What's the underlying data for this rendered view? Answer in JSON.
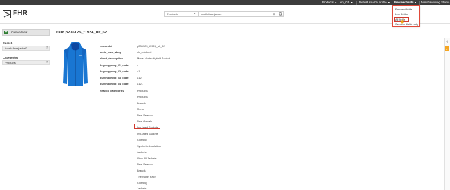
{
  "topbar": {
    "products": "Products",
    "locale": "en_GB",
    "profile": "Default search profile",
    "preview_fields": "Preview fields",
    "studio": "Merchandising Studio"
  },
  "header": {
    "logo_text": "FHR",
    "search_scope": "Products",
    "search_query": "north face jacket"
  },
  "preview_menu": {
    "items": [
      "Preview fields",
      "Live fields",
      "All fields",
      "Secured fields only"
    ],
    "selected": "All fields"
  },
  "sidebar": {
    "create_label": "Create New",
    "search_heading": "Search",
    "search_chip": "\"north face jacket\"",
    "categories_heading": "Categories",
    "categories_chip": "Products"
  },
  "item": {
    "title": "Item p236125_t1924_uk_62",
    "fields": [
      {
        "label": "secondid",
        "value": "p236125_t1924_uk_62"
      },
      {
        "label": "main_web_shop",
        "value": "uk_coldeddi"
      },
      {
        "label": "short_description",
        "value": "Mens Ventro Hybrid Jacket"
      },
      {
        "label": "buyinggroup_l1_code",
        "value": "4"
      },
      {
        "label": "buyinggroup_l2_code",
        "value": "a1"
      },
      {
        "label": "buyinggroup_l3_code",
        "value": "a12"
      },
      {
        "label": "buyinggroup_l4_code",
        "value": "a121"
      }
    ],
    "categories_label": "search_categories",
    "categories": [
      "Products",
      "Products",
      "Brands",
      "Mens",
      "New Season",
      "New Arrivals",
      "Insulated Jackets",
      "Insulated Jackets",
      "Clothing",
      "Synthetic Insulation",
      "Jackets",
      "View All Jackets",
      "New Season",
      "Brands",
      "The North Face",
      "Clothing",
      "Jackets"
    ],
    "highlighted_category": "Insulated Jackets"
  },
  "colors": {
    "topbar_bg": "#3c3c3c",
    "highlight_border": "#d13a2e",
    "create_icon": "#2e7d32",
    "jacket_blue": "#1976d2",
    "badge_orange": "#f5a623"
  },
  "icons": [
    "chevron-down-icon",
    "clear-icon",
    "search-icon",
    "plus-icon",
    "close-icon",
    "hand-cursor-icon",
    "collapse-icon"
  ]
}
